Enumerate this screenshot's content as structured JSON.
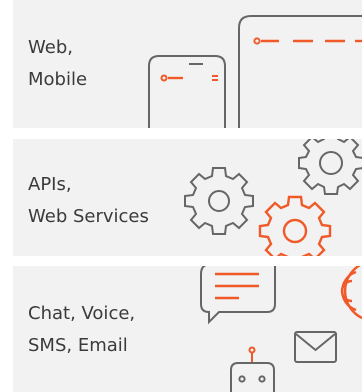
{
  "cards": [
    {
      "line1": "Web,",
      "line2": "Mobile",
      "illustration": "phone-and-tablet-icon"
    },
    {
      "line1": "APIs,",
      "line2": "Web Services",
      "illustration": "gears-icon"
    },
    {
      "line1": "Chat, Voice,",
      "line2": "SMS, Email",
      "illustration": "chat-bot-mail-icon"
    }
  ],
  "colors": {
    "card_bg": "#f2f2f2",
    "text": "#3a3a3a",
    "stroke_gray": "#666666",
    "accent": "#f05a28"
  }
}
